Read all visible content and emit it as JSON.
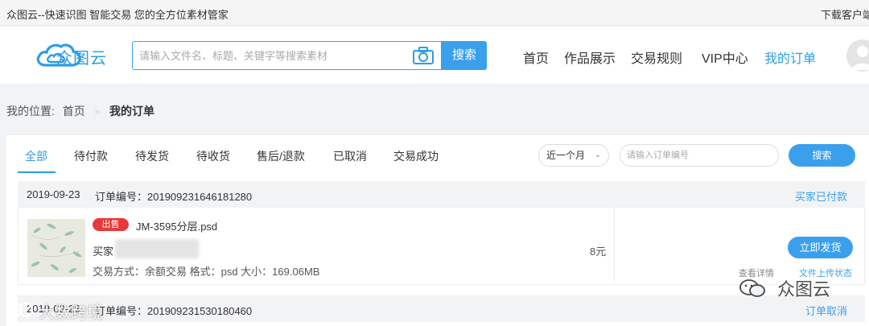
{
  "topbar": {
    "slogan": "众图云--快速识图 智能交易 您的全方位素材管家",
    "download": "下载客户端"
  },
  "header": {
    "logo_text": "众图云",
    "search_placeholder": "请输入文件名、标题、关键字等搜索素材",
    "search_button": "搜索",
    "nav": [
      "首页",
      "作品展示",
      "交易规则",
      "VIP中心",
      "我的订单"
    ],
    "active_nav": "我的订单"
  },
  "breadcrumb": {
    "prefix": "我的位置:",
    "home": "首页",
    "current": "我的订单"
  },
  "tabs": [
    "全部",
    "待付款",
    "待发货",
    "待收货",
    "售后/退款",
    "已取消",
    "交易成功"
  ],
  "filters": {
    "period": "近一个月",
    "order_placeholder": "请输入订单编号",
    "search_button": "搜索"
  },
  "orders": [
    {
      "date": "2019-09-23",
      "no_label": "订单编号：201909231646181280",
      "status": "买家已付款",
      "badge": "出售",
      "file_name": "JM-3595分层.psd",
      "buyer_label": "买家",
      "trade_info": "交易方式：余额交易   格式：psd   大小：169.06MB",
      "price": "8元",
      "action_button": "立即发货",
      "detail_link": "查看详情",
      "upload_link": "文件上传状态"
    },
    {
      "date": "2019-09-23",
      "no_label": "订单编号：201909231530180460",
      "status": "订单取消"
    }
  ],
  "watermarks": {
    "right": "众图云",
    "left": "大数跨境"
  },
  "colors": {
    "accent": "#3aa0ec",
    "badge": "#e8393a"
  }
}
